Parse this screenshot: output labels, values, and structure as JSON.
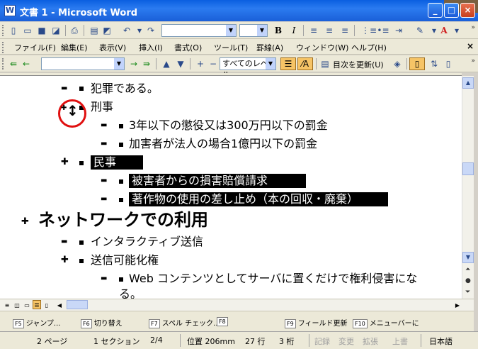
{
  "window": {
    "title": "文書 1 - Microsoft Word"
  },
  "standard_toolbar": {
    "font_name": "",
    "font_size": "",
    "bold_label": "B",
    "italic_label": "I",
    "font_color_label": "A"
  },
  "menu": {
    "items": [
      "ファイル(F)",
      "編集(E)",
      "表示(V)",
      "挿入(I)",
      "書式(O)",
      "ツール(T)",
      "罫線(A)",
      "ウィンドウ(W)",
      "ヘルプ(H)"
    ]
  },
  "outline_toolbar": {
    "level_select": "すべてのレベル",
    "update_toc": "目次を更新(U)"
  },
  "document": {
    "lines": [
      {
        "text": "犯罪である。"
      },
      {
        "text": "刑事"
      },
      {
        "text": "3年以下の懲役又は300万円以下の罰金"
      },
      {
        "text": "加害者が法人の場合1億円以下の罰金"
      },
      {
        "text": "民事"
      },
      {
        "text": "被害者からの損害賠償請求"
      },
      {
        "text": "著作物の使用の差し止め（本の回収・廃棄）"
      },
      {
        "text": "ネットワークでの利用"
      },
      {
        "text": "インタラクティブ送信"
      },
      {
        "text": "送信可能化権"
      },
      {
        "text": "Web コンテンツとしてサーバに置くだけで権利侵害にな"
      },
      {
        "text": "る。"
      }
    ]
  },
  "fkeys": [
    {
      "key": "F5",
      "label": "ジャンプ..."
    },
    {
      "key": "F6",
      "label": "切り替え"
    },
    {
      "key": "F7",
      "label": "スペル チェック..."
    },
    {
      "key": "F8",
      "label": ""
    },
    {
      "key": "F9",
      "label": "フィールド更新"
    },
    {
      "key": "F10",
      "label": "メニューバーに"
    }
  ],
  "status": {
    "page": "2 ページ",
    "section": "1 セクション",
    "page_of": "2/4",
    "position": "位置 206mm",
    "line": "27 行",
    "column": "3 桁",
    "rec": "記録",
    "trk": "変更",
    "ext": "拡張",
    "ovr": "上書",
    "language": "日本語"
  }
}
